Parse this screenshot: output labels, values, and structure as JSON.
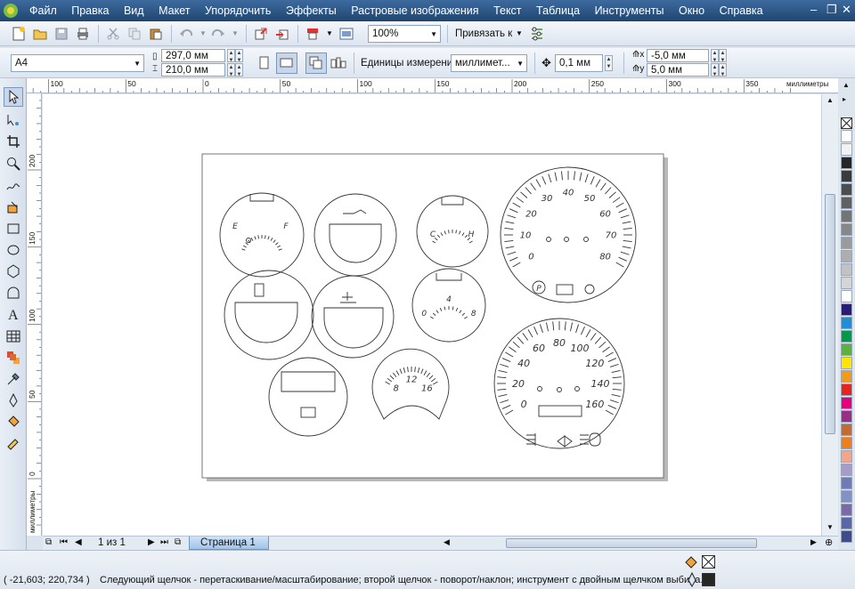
{
  "menubar": {
    "items": [
      "Файл",
      "Правка",
      "Вид",
      "Макет",
      "Упорядочить",
      "Эффекты",
      "Растровые изображения",
      "Текст",
      "Таблица",
      "Инструменты",
      "Окно",
      "Справка"
    ]
  },
  "toolbar": {
    "zoom": "100%",
    "snap_label": "Привязать к"
  },
  "property_bar": {
    "paper_size": "A4",
    "width": "297,0 мм",
    "height": "210,0 мм",
    "units_label": "Единицы измерения:",
    "units_value": "миллимет...",
    "nudge": "0,1 мм",
    "dup_x": "-5,0 мм",
    "dup_y": "5,0 мм"
  },
  "ruler": {
    "top_ticks": [
      "100",
      "50",
      "0",
      "50",
      "100",
      "150",
      "200",
      "250",
      "300",
      "350"
    ],
    "left_ticks": [
      "200",
      "150",
      "100",
      "50",
      "0"
    ],
    "units": "миллиметры"
  },
  "page_nav": {
    "count": "1 из 1",
    "tab": "Страница 1"
  },
  "status": {
    "coords": "( -21,603; 220,734 )",
    "hint": "Следующий щелчок - перетаскивание/масштабирование; второй щелчок - поворот/наклон; инструмент с двойным щелчком выбира..."
  },
  "drawing": {
    "fuel_labels": [
      "E",
      "F"
    ],
    "temp_labels": [
      "C",
      "H"
    ],
    "mini_labels": [
      "0",
      "4",
      "8"
    ],
    "volt_labels": [
      "8",
      "12",
      "16"
    ],
    "tacho_labels": [
      "0",
      "10",
      "20",
      "30",
      "40",
      "50",
      "60",
      "70",
      "80"
    ],
    "speedo_labels": [
      "0",
      "20",
      "40",
      "60",
      "80",
      "100",
      "120",
      "140",
      "160"
    ],
    "parking_label": "P"
  },
  "palette": {
    "colors": [
      "#ffffff",
      "#f2f2f2",
      "#262626",
      "#3a3a3a",
      "#4d4d4d",
      "#606060",
      "#747474",
      "#878787",
      "#9b9b9b",
      "#aeaeae",
      "#c2c2c2",
      "#d5d5d5",
      "#ffffff",
      "#2b1a78",
      "#1e8fd8",
      "#009a49",
      "#5cb33a",
      "#ffe500",
      "#f39a1d",
      "#e8231f",
      "#e6007e",
      "#9b2d84",
      "#c76a2e",
      "#ef7f1a",
      "#f6a38a",
      "#a69bc9",
      "#6f7bb8",
      "#8490c8",
      "#7a6aa8",
      "#5966a8",
      "#3e4d8a"
    ]
  }
}
